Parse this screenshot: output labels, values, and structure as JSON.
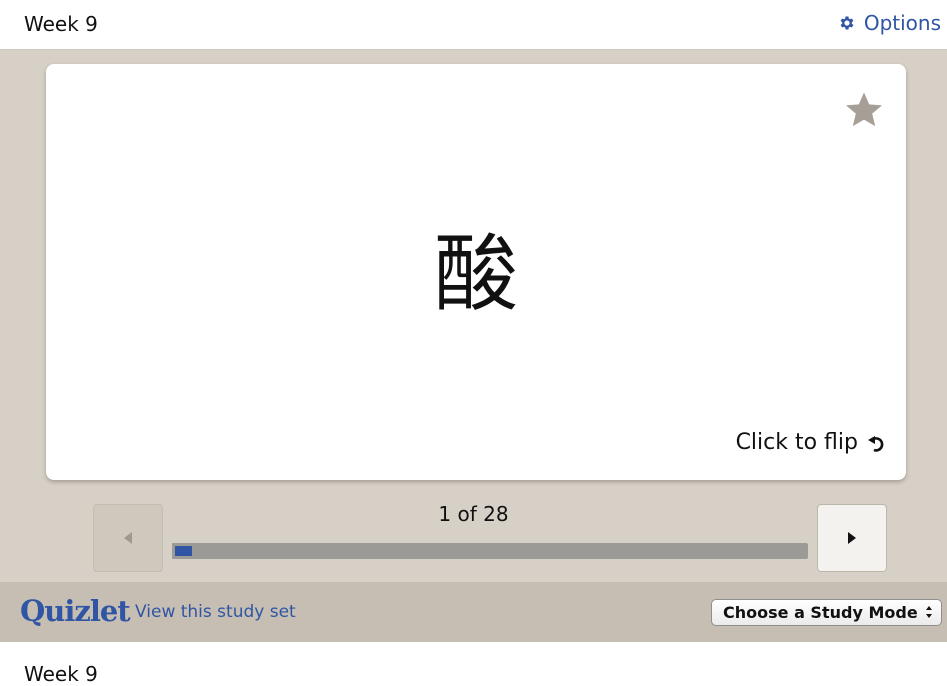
{
  "header": {
    "title": "Week 9",
    "options_label": "Options"
  },
  "card": {
    "term": "酸",
    "flip_label": "Click to flip",
    "starred": false
  },
  "progress": {
    "counter_text": "1 of 28",
    "current": 1,
    "total": 28,
    "fraction": 0.0357
  },
  "footer": {
    "logo": "Quizlet",
    "view_link": "View this study set",
    "study_mode_selected": "Choose a Study Mode"
  },
  "bottom": {
    "title": "Week 9"
  },
  "colors": {
    "accent": "#2f55a4",
    "stage_background": "#d7d0c6",
    "footer_background": "#c6beb2",
    "star": "#a59f95"
  },
  "icons": {
    "options": "gear-icon",
    "favorite": "star-icon",
    "flip": "flip-arrow-icon",
    "previous": "triangle-left-icon",
    "next": "triangle-right-icon",
    "select": "up-down-arrows-icon"
  }
}
